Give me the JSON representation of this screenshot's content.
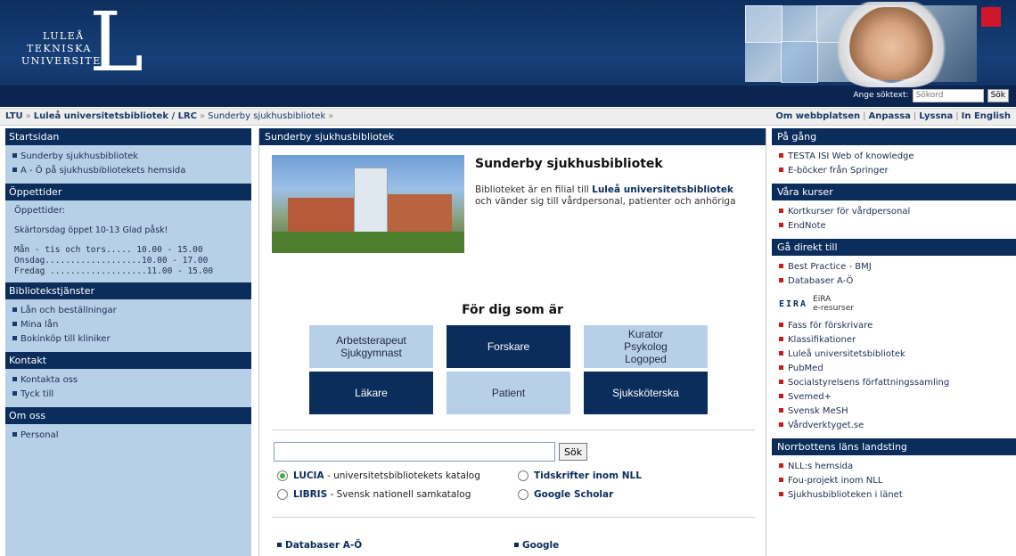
{
  "header": {
    "logo_lines": [
      "LULEÅ",
      "TEKNISKA",
      "UNIVERSITET"
    ],
    "logo_letter": "L",
    "search_label": "Ange söktext:",
    "search_placeholder": "Sökord",
    "search_button": "Sök"
  },
  "breadcrumb": {
    "items": [
      "LTU",
      "Luleå universitetsbibliotek / LRC",
      "Sunderby sjukhusbibliotek"
    ],
    "separator": "»"
  },
  "top_links": [
    "Om webbplatsen",
    "Anpassa",
    "Lyssna",
    "In English"
  ],
  "left_sidebar": {
    "sections": [
      {
        "title": "Startsidan",
        "items": [
          "Sunderby sjukhusbibliotek",
          "A - Ö på sjukhusbibliotekets hemsida"
        ]
      },
      {
        "title": "Öppettider"
      },
      {
        "title": "Bibliotekstjänster",
        "items": [
          "Lån och beställningar",
          "Mina lån",
          "Bokinköp till kliniker"
        ]
      },
      {
        "title": "Kontakt",
        "items": [
          "Kontakta oss",
          "Tyck till"
        ]
      },
      {
        "title": "Om oss",
        "items": [
          "Personal"
        ]
      }
    ],
    "hours": {
      "label": "Öppettider:",
      "note": "Skärtorsdag öppet 10-13 Glad påsk!",
      "rows": [
        "Mån - tis och tors..... 10.00 - 15.00",
        "Onsdag...................10.00 - 17.00",
        "Fredag ...................11.00 - 15.00"
      ]
    }
  },
  "main": {
    "header": "Sunderby sjukhusbibliotek",
    "title": "Sunderby sjukhusbibliotek",
    "intro_prefix": "Biblioteket är en filial till",
    "intro_link": "Luleå universitetsbibliotek",
    "intro_suffix": "och vänder sig till vårdpersonal, patienter och anhöriga",
    "for_dig": "För dig som är",
    "roles": [
      {
        "label": "Arbetsterapeut\nSjukgymnast",
        "style": "light"
      },
      {
        "label": "Forskare",
        "style": "dark"
      },
      {
        "label": "Kurator\nPsykolog\nLogoped",
        "style": "light"
      },
      {
        "label": "Läkare",
        "style": "dark"
      },
      {
        "label": "Patient",
        "style": "light"
      },
      {
        "label": "Sjuksköterska",
        "style": "dark"
      }
    ],
    "search_button": "Sök",
    "search_options": [
      {
        "name": "LUCIA",
        "desc": "- universitetsbibliotekets katalog",
        "selected": true
      },
      {
        "name": "Tidskrifter inom NLL",
        "desc": "",
        "selected": false
      },
      {
        "name": "LIBRIS",
        "desc": "- Svensk nationell samkatalog",
        "selected": false
      },
      {
        "name": "Google Scholar",
        "desc": "",
        "selected": false
      }
    ],
    "bottom_links": [
      "Databaser A-Ö",
      "Google"
    ]
  },
  "right_sidebar": {
    "sections": [
      {
        "title": "På gång",
        "items": [
          "TESTA ISI Web of knowledge",
          "E-böcker från Springer"
        ]
      },
      {
        "title": "Våra kurser",
        "items": [
          "Kortkurser för vårdpersonal",
          "EndNote"
        ]
      },
      {
        "title": "Gå direkt till",
        "items_a": [
          "Best Practice - BMJ",
          "Databaser A-Ö"
        ],
        "items_b": [
          "Fass för förskrivare",
          "Klassifikationer",
          "Luleå universitetsbibliotek",
          "PubMed",
          "Socialstyrelsens författningssamling",
          "Svemed+",
          "Svensk MeSH",
          "Vårdverktyget.se"
        ]
      },
      {
        "title": "Norrbottens läns landsting",
        "items": [
          "NLL:s hemsida",
          "Fou-projekt inom NLL",
          "Sjukhusbiblioteken i länet"
        ]
      }
    ],
    "eira": {
      "mark": "EIRA",
      "name": "EiRA",
      "sub": "e-resurser"
    }
  },
  "colors": {
    "navy": "#0b2d5c",
    "light_blue": "#b8cfe8",
    "red_bullet": "#cc1a1a",
    "radio_green": "#3fae3f"
  }
}
